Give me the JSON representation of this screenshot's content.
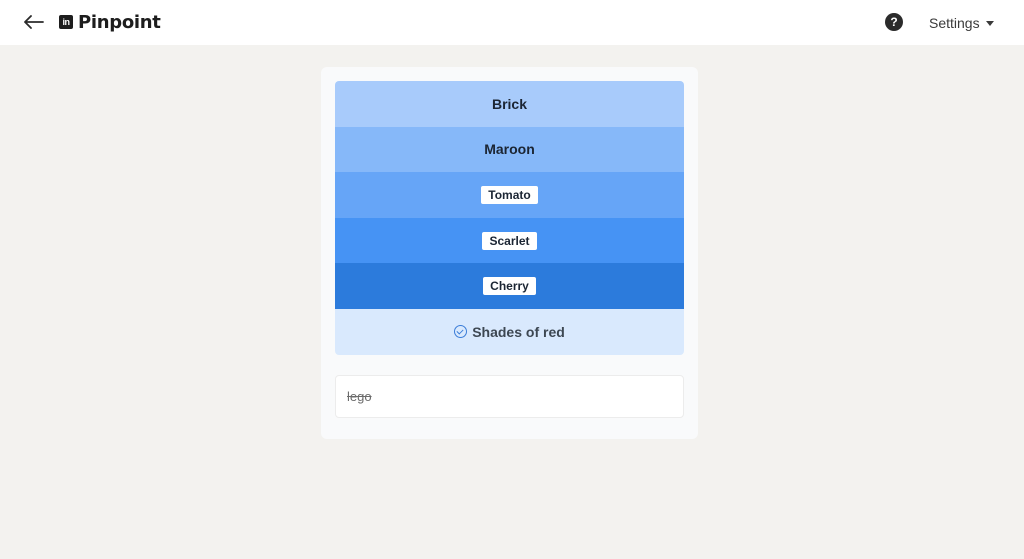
{
  "header": {
    "back_icon": "arrow-left-icon",
    "logo_text": "in",
    "title": "Pinpoint",
    "help_symbol": "?",
    "settings_label": "Settings"
  },
  "game": {
    "clues": [
      {
        "label": "Brick",
        "revealed": true,
        "color": "#a8cbfb"
      },
      {
        "label": "Maroon",
        "revealed": true,
        "color": "#86b8f9"
      },
      {
        "label": "Tomato",
        "revealed": false,
        "color": "#66a5f7"
      },
      {
        "label": "Scarlet",
        "revealed": false,
        "color": "#4693f4"
      },
      {
        "label": "Cherry",
        "revealed": false,
        "color": "#2c7bdc"
      }
    ],
    "answer": "Shades of red",
    "guesses": [
      "lego"
    ]
  },
  "colors": {
    "background": "#f3f2ef",
    "answer_bg": "#d9e9fd",
    "accent": "#3b7dd8"
  }
}
